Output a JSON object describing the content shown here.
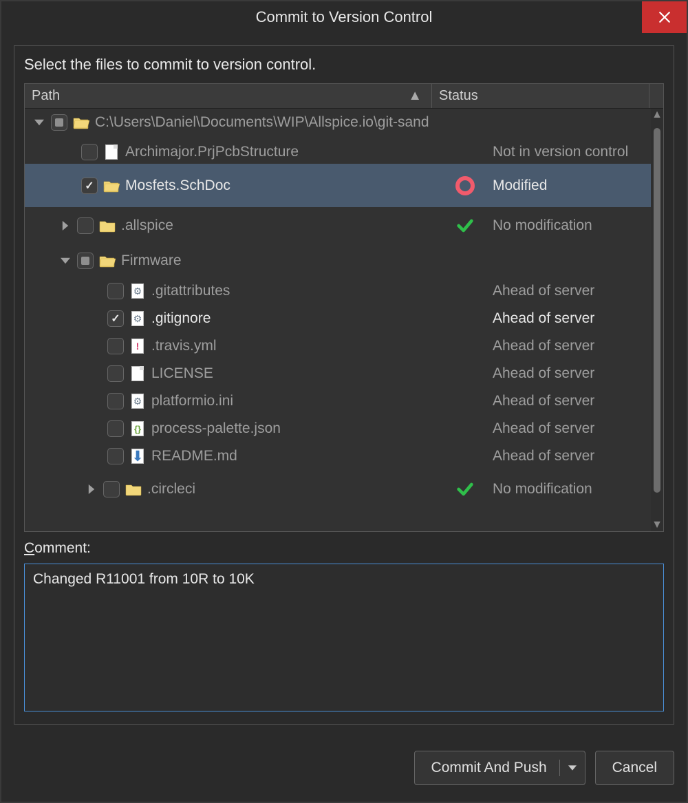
{
  "titlebar": {
    "title": "Commit to Version Control"
  },
  "instruction": "Select the files to commit to version control.",
  "columns": {
    "path": "Path",
    "status": "Status"
  },
  "root": {
    "label": "C:\\Users\\Daniel\\Documents\\WIP\\Allspice.io\\git-sand",
    "items": [
      {
        "name": "Archimajor.PrjPcbStructure",
        "status": "Not in version control"
      },
      {
        "name": "Mosfets.SchDoc",
        "status": "Modified"
      },
      {
        "name": ".allspice",
        "status": "No modification"
      }
    ],
    "firmware": {
      "name": "Firmware",
      "items": [
        {
          "name": ".gitattributes",
          "status": "Ahead of server"
        },
        {
          "name": ".gitignore",
          "status": "Ahead of server"
        },
        {
          "name": ".travis.yml",
          "status": "Ahead of server"
        },
        {
          "name": "LICENSE",
          "status": "Ahead of server"
        },
        {
          "name": "platformio.ini",
          "status": "Ahead of server"
        },
        {
          "name": "process-palette.json",
          "status": "Ahead of server"
        },
        {
          "name": "README.md",
          "status": "Ahead of server"
        }
      ]
    },
    "circleci": {
      "name": ".circleci",
      "status": "No modification"
    }
  },
  "comment": {
    "label_prefix": "C",
    "label_rest": "omment:",
    "value": "Changed R11001 from 10R to 10K"
  },
  "buttons": {
    "commit": "Commit And Push",
    "cancel": "Cancel"
  }
}
